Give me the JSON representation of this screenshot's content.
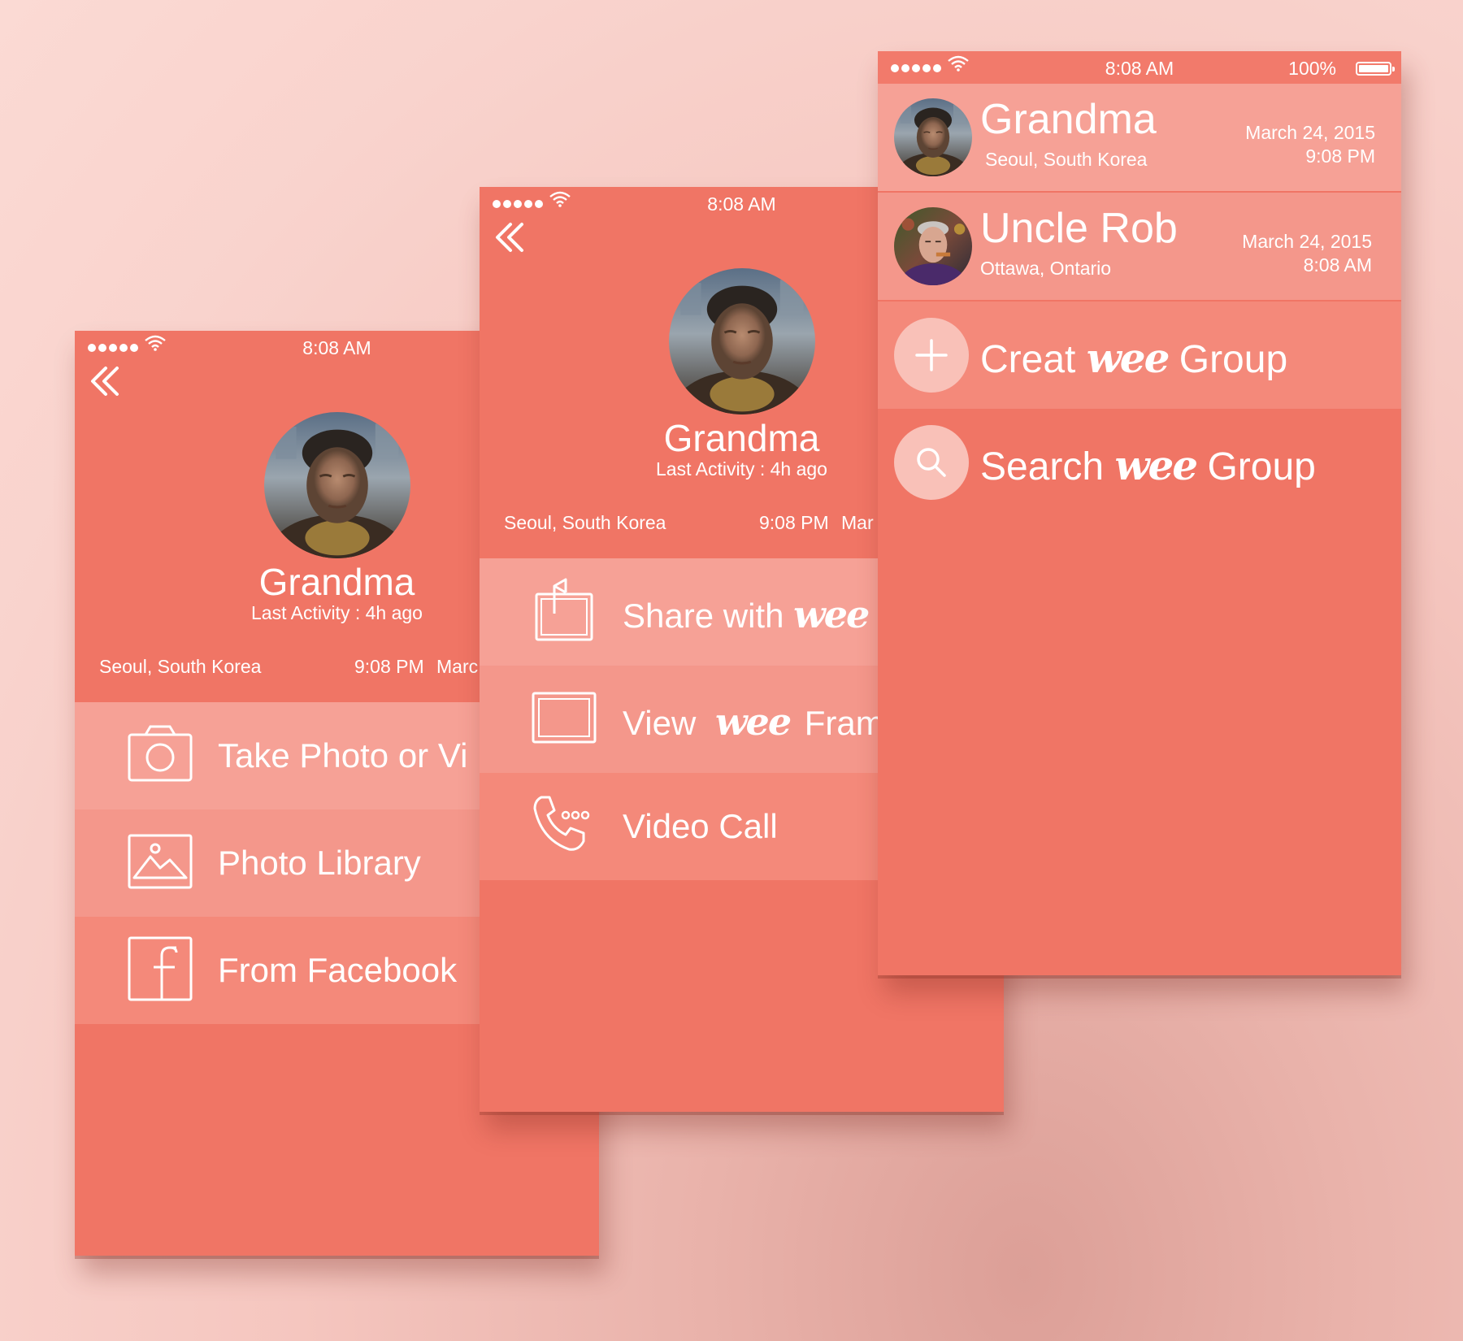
{
  "colors": {
    "primary": "#f07565",
    "row_light": "#f6a196",
    "row_mid": "#f4978b",
    "row_soft": "#f4897a",
    "background": "#f9d3cd"
  },
  "status_bar": {
    "time": "8:08 AM",
    "battery": "100%"
  },
  "icons": {
    "back": "double-chevron-left-icon",
    "camera": "camera-icon",
    "photo_library": "image-icon",
    "facebook": "facebook-icon",
    "share": "share-frame-icon",
    "frame": "frame-icon",
    "video_call": "phone-call-icon",
    "plus": "plus-icon",
    "search": "search-icon"
  },
  "brand": {
    "wee": "wee"
  },
  "screen_upload": {
    "profile": {
      "name": "Grandma",
      "last_activity": "Last Activity : 4h ago",
      "location": "Seoul, South Korea",
      "time": "9:08 PM",
      "date": "Marc"
    },
    "menu": [
      {
        "label": "Take Photo or Vi"
      },
      {
        "label": "Photo Library"
      },
      {
        "label": "From Facebook"
      }
    ]
  },
  "screen_profile": {
    "profile": {
      "name": "Grandma",
      "last_activity": "Last Activity : 4h ago",
      "location": "Seoul, South Korea",
      "time": "9:08 PM",
      "date": "Mar"
    },
    "menu": {
      "share_prefix": "Share with",
      "view_prefix": "View",
      "view_suffix": "Fram",
      "video_call": "Video Call"
    }
  },
  "screen_contacts": {
    "contacts": [
      {
        "name": "Grandma",
        "location": "Seoul, South Korea",
        "date": "March 24, 2015",
        "time": "9:08 PM"
      },
      {
        "name": "Uncle Rob",
        "location": "Ottawa, Ontario",
        "date": "March 24, 2015",
        "time": "8:08 AM"
      }
    ],
    "actions": {
      "create_prefix": "Creat",
      "search_prefix": "Search",
      "group_suffix": "Group"
    }
  }
}
